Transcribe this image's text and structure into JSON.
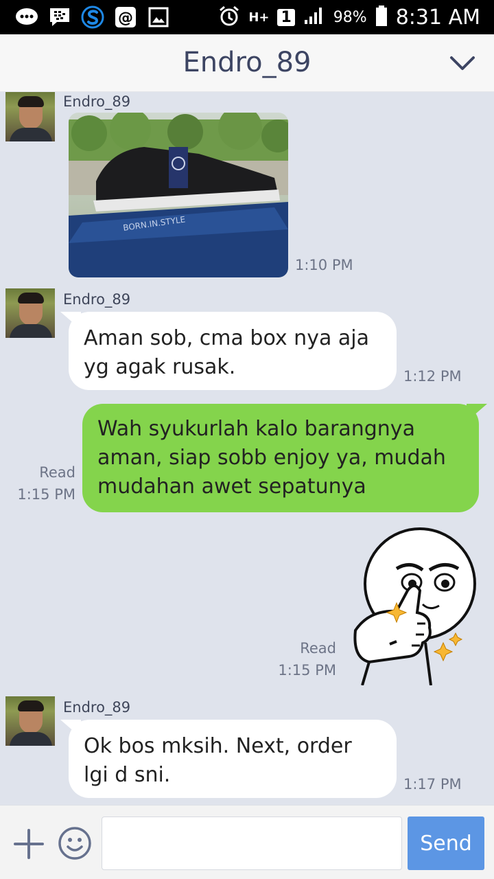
{
  "status_bar": {
    "battery": "98%",
    "time": "8:31 AM",
    "network": "H+",
    "sim": "1"
  },
  "header": {
    "title": "Endro_89"
  },
  "messages": [
    {
      "sender": "Endro_89",
      "type": "image",
      "time": "1:10 PM"
    },
    {
      "sender": "Endro_89",
      "type": "text",
      "text_line1": "Aman sob, cma box nya aja",
      "text_line2": "yg agak rusak.",
      "time": "1:12 PM"
    },
    {
      "type": "text-out",
      "text_line1": "Wah syukurlah kalo barangnya",
      "text_line2": "aman, siap sobb enjoy ya, mudah",
      "text_line3": "mudahan awet sepatunya",
      "read": "Read",
      "time": "1:15 PM"
    },
    {
      "type": "sticker-out",
      "read": "Read",
      "time": "1:15 PM"
    },
    {
      "sender": "Endro_89",
      "type": "text",
      "text_line1": "Ok bos mksih. Next, order",
      "text_line2": "lgi d sni.",
      "time": "1:17 PM"
    }
  ],
  "input": {
    "placeholder": "",
    "send_label": "Send"
  }
}
